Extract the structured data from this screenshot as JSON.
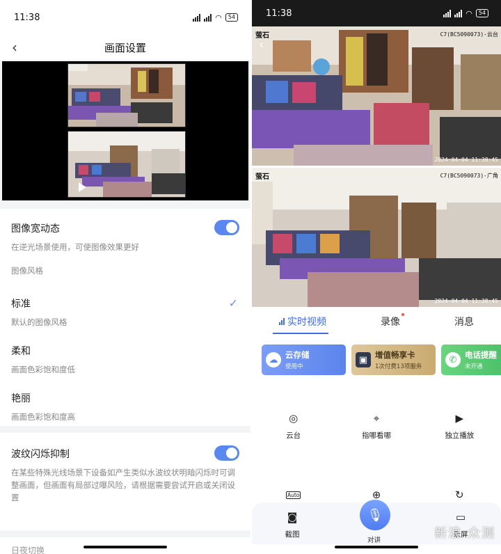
{
  "left": {
    "status": {
      "time": "11:38",
      "battery": "54"
    },
    "navbar": {
      "title": "画面设置"
    },
    "wdr": {
      "title": "图像宽动态",
      "desc": "在逆光场景使用，可使图像效果更好",
      "enabled": true
    },
    "style_section": {
      "label": "图像风格"
    },
    "styles": [
      {
        "title": "标准",
        "desc": "默认的图像风格",
        "selected": true
      },
      {
        "title": "柔和",
        "desc": "画面色彩饱和度低",
        "selected": false
      },
      {
        "title": "艳丽",
        "desc": "画面色彩饱和度高",
        "selected": false
      }
    ],
    "flicker": {
      "title": "波纹闪烁抑制",
      "desc": "在某些特殊光线场景下设备如产生类似水波纹状明暗闪烁时可调整画面，但画面有局部过曝风险，请根据需要尝试开启或关闭设置",
      "enabled": true
    },
    "cutoff_item": "日夜切换"
  },
  "right": {
    "status": {
      "time": "11:38",
      "battery": "54"
    },
    "cams": [
      {
        "logo": "萤石",
        "name": "C7(BC5090073)-云台",
        "time": "2024-04-04 11:38:45"
      },
      {
        "logo": "萤石",
        "name": "C7(BC5090073)-广角",
        "time": "2024-04-04 11:38:45"
      }
    ],
    "tabs": {
      "live": "实时视频",
      "record": "录像",
      "message": "消息"
    },
    "services": [
      {
        "title": "云存储",
        "sub": "使用中",
        "icon": "cloud-icon"
      },
      {
        "title": "增值畅享卡",
        "sub": "1次付费13项服务",
        "icon": "card-icon"
      },
      {
        "title": "电话提醒",
        "sub": "未开通",
        "icon": "phone-icon"
      }
    ],
    "functions": {
      "ptz": "云台",
      "point": "指哪看哪",
      "playback": "独立播放",
      "screenshot": "截图",
      "record": "录屏",
      "talk": "对讲",
      "auto": "Auto"
    },
    "watermark": "新浪 众测"
  },
  "colors": {
    "accent": "#3c6be6",
    "toggle": "#5a87f0"
  }
}
